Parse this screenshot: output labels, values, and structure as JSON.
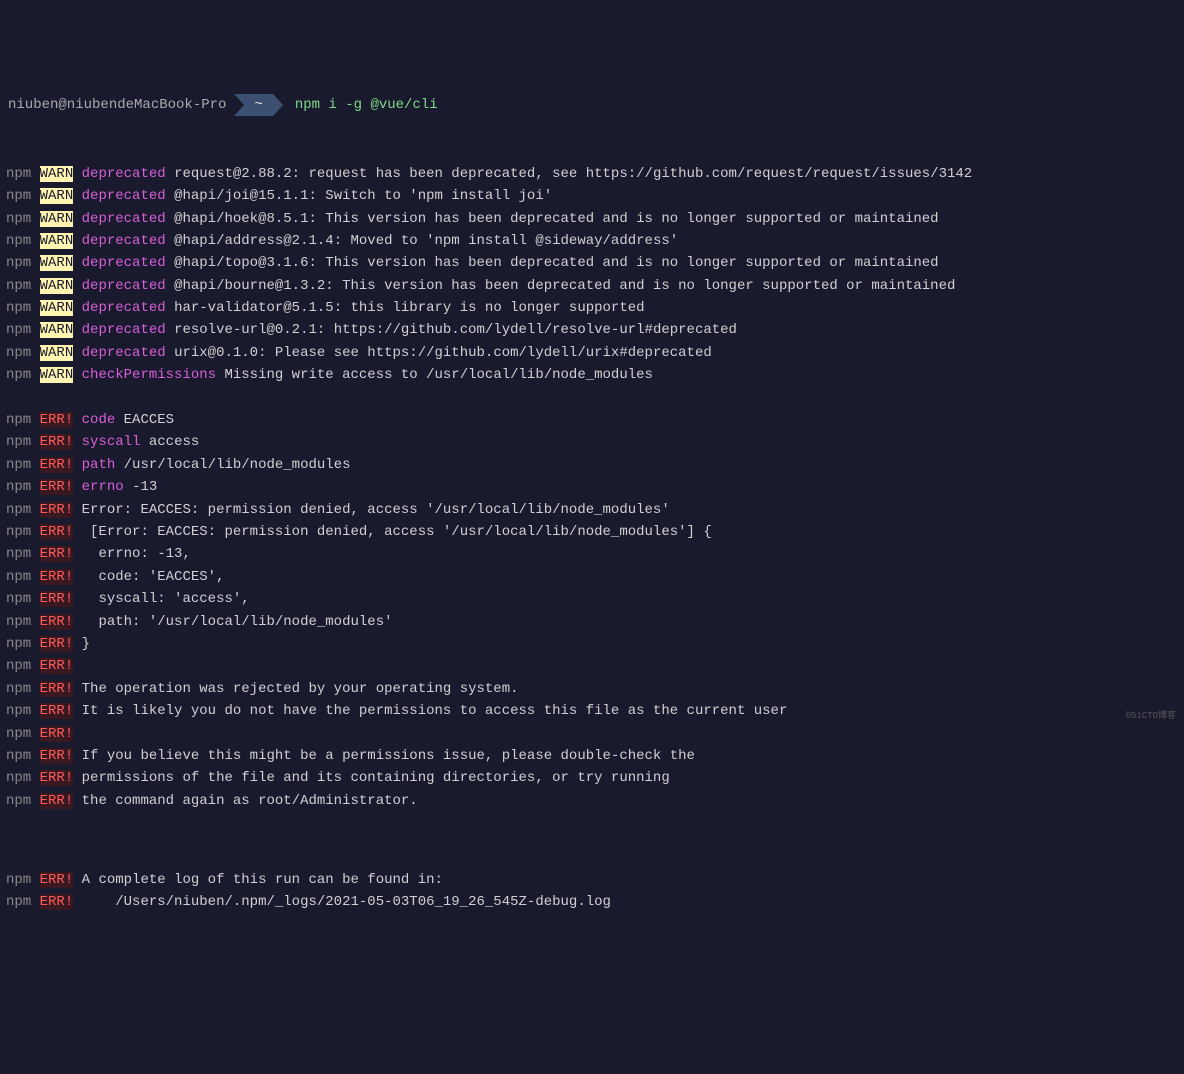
{
  "prompt": {
    "user": "niuben@niubendeMacBook-Pro",
    "path": "~",
    "command": "npm i -g @vue/cli"
  },
  "warnLines": [
    {
      "label": "deprecated",
      "text": "request@2.88.2: request has been deprecated, see https://github.com/request/request/issues/3142"
    },
    {
      "label": "deprecated",
      "text": "@hapi/joi@15.1.1: Switch to 'npm install joi'"
    },
    {
      "label": "deprecated",
      "text": "@hapi/hoek@8.5.1: This version has been deprecated and is no longer supported or maintained"
    },
    {
      "label": "deprecated",
      "text": "@hapi/address@2.1.4: Moved to 'npm install @sideway/address'"
    },
    {
      "label": "deprecated",
      "text": "@hapi/topo@3.1.6: This version has been deprecated and is no longer supported or maintained"
    },
    {
      "label": "deprecated",
      "text": "@hapi/bourne@1.3.2: This version has been deprecated and is no longer supported or maintained"
    },
    {
      "label": "deprecated",
      "text": "har-validator@5.1.5: this library is no longer supported"
    },
    {
      "label": "deprecated",
      "text": "resolve-url@0.2.1: https://github.com/lydell/resolve-url#deprecated"
    },
    {
      "label": "deprecated",
      "text": "urix@0.1.0: Please see https://github.com/lydell/urix#deprecated"
    },
    {
      "label": "checkPermissions",
      "text": "Missing write access to /usr/local/lib/node_modules"
    }
  ],
  "errLines": [
    {
      "label": "code",
      "text": "EACCES"
    },
    {
      "label": "syscall",
      "text": "access"
    },
    {
      "label": "path",
      "text": "/usr/local/lib/node_modules"
    },
    {
      "label": "errno",
      "text": "-13"
    },
    {
      "label": "",
      "text": "Error: EACCES: permission denied, access '/usr/local/lib/node_modules'"
    },
    {
      "label": "",
      "text": " [Error: EACCES: permission denied, access '/usr/local/lib/node_modules'] {"
    },
    {
      "label": "",
      "text": "  errno: -13,"
    },
    {
      "label": "",
      "text": "  code: 'EACCES',"
    },
    {
      "label": "",
      "text": "  syscall: 'access',"
    },
    {
      "label": "",
      "text": "  path: '/usr/local/lib/node_modules'"
    },
    {
      "label": "",
      "text": "}"
    },
    {
      "label": "",
      "text": ""
    },
    {
      "label": "",
      "text": "The operation was rejected by your operating system."
    },
    {
      "label": "",
      "text": "It is likely you do not have the permissions to access this file as the current user"
    },
    {
      "label": "",
      "text": ""
    },
    {
      "label": "",
      "text": "If you believe this might be a permissions issue, please double-check the"
    },
    {
      "label": "",
      "text": "permissions of the file and its containing directories, or try running"
    },
    {
      "label": "",
      "text": "the command again as root/Administrator."
    }
  ],
  "errLines2": [
    {
      "label": "",
      "text": "A complete log of this run can be found in:"
    },
    {
      "label": "",
      "text": "    /Users/niuben/.npm/_logs/2021-05-03T06_19_26_545Z-debug.log"
    }
  ],
  "watermark": "©51CTO博客"
}
